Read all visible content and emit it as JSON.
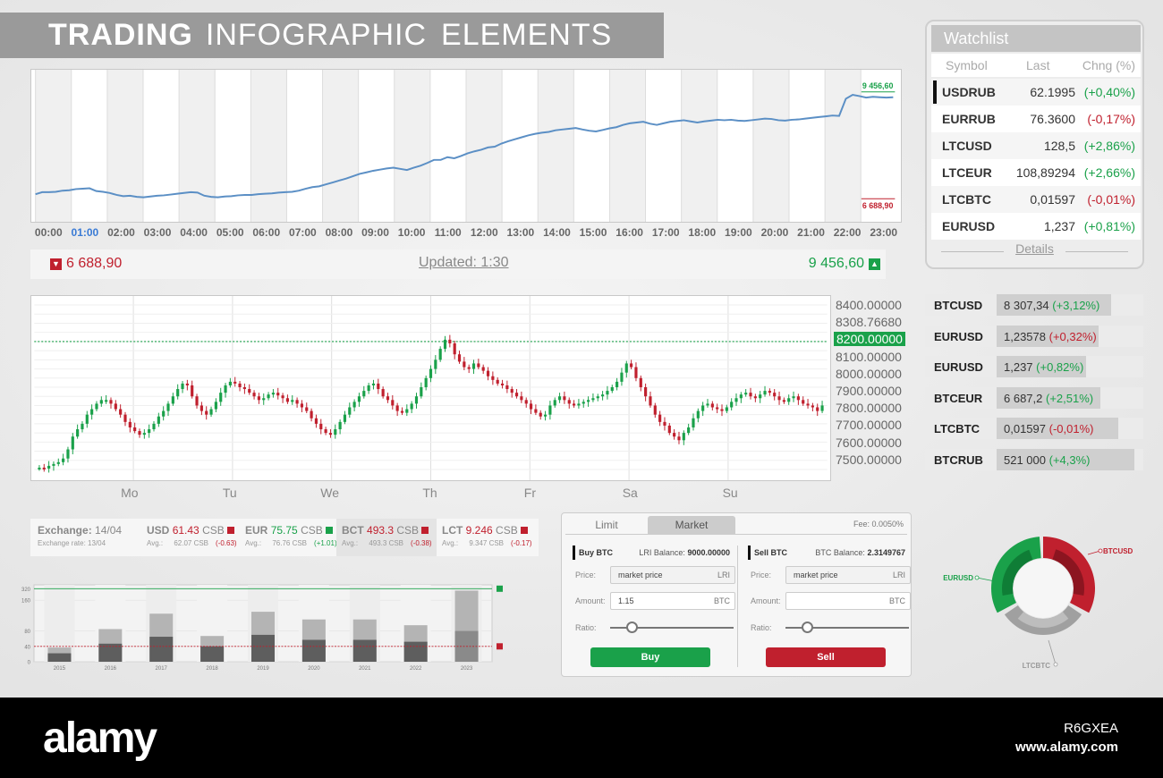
{
  "title": {
    "bold": "TRADING",
    "light1": "INFOGRAPHIC",
    "light2": "ELEMENTS"
  },
  "line_chart": {
    "hours": [
      "00:00",
      "01:00",
      "02:00",
      "03:00",
      "04:00",
      "05:00",
      "06:00",
      "07:00",
      "08:00",
      "09:00",
      "10:00",
      "11:00",
      "12:00",
      "13:00",
      "14:00",
      "15:00",
      "16:00",
      "17:00",
      "18:00",
      "19:00",
      "20:00",
      "21:00",
      "22:00",
      "23:00"
    ],
    "active_hour": 1,
    "max_label": "9 456,60",
    "min_label": "6 688,90",
    "line_color": "#5b8fc5",
    "values": [
      6.9,
      6.95,
      6.95,
      6.96,
      6.99,
      7.0,
      7.03,
      7.04,
      7.05,
      6.98,
      6.96,
      6.93,
      6.88,
      6.85,
      6.86,
      6.83,
      6.82,
      6.84,
      6.86,
      6.87,
      6.89,
      6.91,
      6.93,
      6.95,
      6.94,
      6.86,
      6.83,
      6.82,
      6.84,
      6.85,
      6.87,
      6.88,
      6.88,
      6.9,
      6.91,
      6.92,
      6.94,
      6.95,
      6.96,
      6.99,
      7.04,
      7.08,
      7.1,
      7.15,
      7.2,
      7.25,
      7.3,
      7.36,
      7.42,
      7.46,
      7.5,
      7.53,
      7.56,
      7.58,
      7.55,
      7.52,
      7.58,
      7.63,
      7.7,
      7.78,
      7.78,
      7.85,
      7.82,
      7.88,
      7.95,
      8.0,
      8.04,
      8.1,
      8.12,
      8.2,
      8.26,
      8.31,
      8.36,
      8.41,
      8.45,
      8.48,
      8.5,
      8.54,
      8.56,
      8.58,
      8.6,
      8.56,
      8.53,
      8.51,
      8.55,
      8.59,
      8.62,
      8.68,
      8.72,
      8.74,
      8.76,
      8.71,
      8.68,
      8.72,
      8.76,
      8.78,
      8.8,
      8.77,
      8.74,
      8.77,
      8.79,
      8.81,
      8.8,
      8.81,
      8.79,
      8.78,
      8.8,
      8.82,
      8.84,
      8.83,
      8.8,
      8.79,
      8.81,
      8.82,
      8.84,
      8.86,
      8.88,
      8.9,
      8.92,
      8.91,
      9.35,
      9.45,
      9.42,
      9.38,
      9.4,
      9.39,
      9.38,
      9.39
    ]
  },
  "range_bar": {
    "min": "6 688,90",
    "max": "9 456,60",
    "updated": "Updated: 1:30"
  },
  "candle_chart": {
    "price_labels": [
      "8400.00000",
      "8308.76680",
      "8200.00000",
      "8100.00000",
      "8000.00000",
      "7900.00000",
      "7800.00000",
      "7700.00000",
      "7600.00000",
      "7500.00000"
    ],
    "highlight_price": "8200.00000",
    "days": [
      "Mo",
      "Tu",
      "We",
      "Th",
      "Fr",
      "Sa",
      "Su"
    ],
    "up_color": "#1aa14a",
    "down_color": "#c0202e",
    "closes": [
      7510,
      7505,
      7520,
      7530,
      7540,
      7560,
      7610,
      7680,
      7720,
      7750,
      7800,
      7830,
      7860,
      7880,
      7880,
      7860,
      7830,
      7800,
      7760,
      7730,
      7710,
      7690,
      7700,
      7720,
      7750,
      7790,
      7820,
      7860,
      7900,
      7940,
      7970,
      7960,
      7900,
      7850,
      7820,
      7800,
      7830,
      7870,
      7920,
      7960,
      7980,
      7970,
      7950,
      7940,
      7920,
      7900,
      7880,
      7890,
      7910,
      7920,
      7905,
      7890,
      7870,
      7880,
      7860,
      7840,
      7820,
      7780,
      7750,
      7720,
      7700,
      7690,
      7720,
      7760,
      7800,
      7840,
      7870,
      7900,
      7930,
      7960,
      7970,
      7940,
      7900,
      7880,
      7850,
      7820,
      7810,
      7830,
      7860,
      7900,
      7950,
      8000,
      8050,
      8100,
      8160,
      8210,
      8190,
      8130,
      8090,
      8060,
      8050,
      8080,
      8060,
      8040,
      8010,
      7990,
      7970,
      7960,
      7940,
      7920,
      7900,
      7880,
      7860,
      7830,
      7810,
      7790,
      7800,
      7850,
      7880,
      7900,
      7880,
      7860,
      7850,
      7860,
      7870,
      7880,
      7890,
      7900,
      7910,
      7930,
      7950,
      7980,
      8030,
      8080,
      8060,
      8000,
      7950,
      7900,
      7850,
      7800,
      7760,
      7740,
      7700,
      7680,
      7660,
      7700,
      7730,
      7780,
      7820,
      7850,
      7860,
      7840,
      7830,
      7820,
      7840,
      7870,
      7890,
      7910,
      7920,
      7900,
      7890,
      7910,
      7930,
      7920,
      7900,
      7880,
      7870,
      7890,
      7900,
      7880,
      7860,
      7850,
      7840,
      7820,
      7850
    ]
  },
  "watchlist": {
    "title": "Watchlist",
    "headers": [
      "Symbol",
      "Last",
      "Chng (%)"
    ],
    "rows": [
      {
        "symbol": "USDRUB",
        "last": "62.1995",
        "change": "(+0,40%)",
        "dir": "pos",
        "selected": true
      },
      {
        "symbol": "EURRUB",
        "last": "76.3600",
        "change": "(-0,17%)",
        "dir": "neg",
        "selected": false
      },
      {
        "symbol": "LTCUSD",
        "last": "128,5",
        "change": "(+2,86%)",
        "dir": "pos",
        "selected": false
      },
      {
        "symbol": "LTCEUR",
        "last": "108,89294",
        "change": "(+2,66%)",
        "dir": "pos",
        "selected": false
      },
      {
        "symbol": "LTCBTC",
        "last": "0,01597",
        "change": "(-0,01%)",
        "dir": "neg",
        "selected": false
      },
      {
        "symbol": "EURUSD",
        "last": "1,237",
        "change": "(+0,81%)",
        "dir": "pos",
        "selected": false
      }
    ],
    "details": "Details"
  },
  "quotes": [
    {
      "symbol": "BTCUSD",
      "price": "8 307,34",
      "change": "(+3,12%)",
      "dir": "pos"
    },
    {
      "symbol": "EURUSD",
      "price": "1,23578",
      "change": "(+0,32%)",
      "dir": "neg"
    },
    {
      "symbol": "EURUSD",
      "price": "1,237",
      "change": "(+0,82%)",
      "dir": "pos"
    },
    {
      "symbol": "BTCEUR",
      "price": "6 687,2",
      "change": "(+2,51%)",
      "dir": "pos"
    },
    {
      "symbol": "LTCBTC",
      "price": "0,01597",
      "change": "(-0,01%)",
      "dir": "neg"
    },
    {
      "symbol": "BTCRUB",
      "price": "521 000",
      "change": "(+4,3%)",
      "dir": "pos"
    }
  ],
  "exchange": {
    "label": "Exchange:",
    "date": "14/04",
    "rate_label": "Exchange rate: 13/04",
    "items": [
      {
        "sym": "USD",
        "val": "61.43",
        "unit": "CSB",
        "avg_label": "Avg.:",
        "avg": "62.07 CSB",
        "delta": "(-0.63)",
        "dir": "neg"
      },
      {
        "sym": "EUR",
        "val": "75.75",
        "unit": "CSB",
        "avg_label": "Avg.:",
        "avg": "76.76 CSB",
        "delta": "(+1.01)",
        "dir": "pos"
      },
      {
        "sym": "BCT",
        "val": "493.3",
        "unit": "CSB",
        "avg_label": "Avg.:",
        "avg": "493.3 CSB",
        "delta": "(-0.38)",
        "dir": "neg"
      },
      {
        "sym": "LCT",
        "val": "9.246",
        "unit": "CSB",
        "avg_label": "Avg.:",
        "avg": "9.347 CSB",
        "delta": "(-0.17)",
        "dir": "neg"
      }
    ]
  },
  "chart_data": {
    "type": "bar",
    "categories": [
      "2015",
      "2016",
      "2017",
      "2018",
      "2019",
      "2020",
      "2021",
      "2022",
      "2023"
    ],
    "series": [
      {
        "values": [
          37,
          85,
          125,
          67,
          130,
          110,
          110,
          95,
          185
        ]
      },
      {
        "values": [
          22,
          47,
          65,
          40,
          70,
          57,
          57,
          52,
          80
        ]
      }
    ],
    "y_ticks": [
      0,
      40,
      80,
      160,
      320
    ],
    "ylim": [
      0,
      200
    ],
    "upper_line": 190,
    "lower_line": 40
  },
  "order_panel": {
    "tabs": [
      "Limit",
      "Market"
    ],
    "fee": "Fee: 0.0050%",
    "buy": {
      "title": "Buy BTC",
      "balance_label": "LRI Balance:",
      "balance": "9000.00000",
      "price_label": "Price:",
      "price": "market price",
      "price_unit": "LRI",
      "amount_label": "Amount:",
      "amount": "1.15",
      "amount_unit": "BTC",
      "ratio_label": "Ratio:",
      "button": "Buy"
    },
    "sell": {
      "title": "Sell BTC",
      "balance_label": "BTC Balance:",
      "balance": "2.3149767",
      "price_label": "Price:",
      "price": "market price",
      "price_unit": "LRI",
      "amount_label": "Amount:",
      "amount": "",
      "amount_unit": "BTC",
      "ratio_label": "Ratio:",
      "button": "Sell"
    }
  },
  "donut": {
    "labels": {
      "btcusd": "BTCUSD",
      "eurusd": "EURUSD",
      "ltcbtc": "LTCBTC"
    },
    "colors": {
      "btcusd": "#c0202e",
      "eurusd": "#1aa14a",
      "ltcbtc": "#a0a0a0"
    }
  },
  "footer": {
    "logo": "alamy",
    "id": "R6GXEA",
    "url": "www.alamy.com"
  }
}
